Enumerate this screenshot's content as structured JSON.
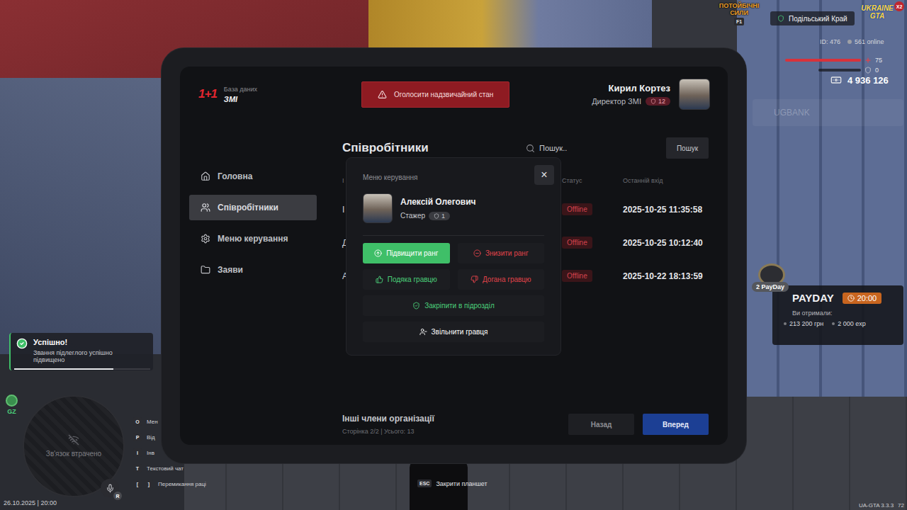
{
  "hud": {
    "event_logo": {
      "title": "ПОТОЙБІЧНІ СИЛИ",
      "key": "F1"
    },
    "server": "Подільський Край",
    "game_logo": {
      "title": "UKRAINE GTA",
      "badge": "X2"
    },
    "player_id": "ID: 476",
    "online": "561 online",
    "health": {
      "value": "75",
      "level": 1
    },
    "armor": {
      "value": "0",
      "level": 0
    },
    "money": "4 936 126",
    "bank": "UGBANK",
    "payday": {
      "count": "2 PayDay",
      "title": "PAYDAY",
      "time": "20:00",
      "received_label": "Ви отримали:",
      "rewards": [
        "213 200 грн",
        "2 000 exp"
      ]
    },
    "notification": {
      "title": "Успішно!",
      "message": "Звання підлеглого успішно підвищено",
      "level": 0.73
    },
    "zone": "GZ",
    "minimap_status": "Зв'язок втрачено",
    "voice_key": "R",
    "hints": [
      {
        "keys": [
          "O"
        ],
        "label": "Мен"
      },
      {
        "keys": [
          "P"
        ],
        "label": "Від"
      },
      {
        "keys": [
          "I"
        ],
        "label": "Інв"
      },
      {
        "keys": [
          "T"
        ],
        "label": "Текстовий чат"
      },
      {
        "keys": [
          "[",
          "]"
        ],
        "label": "Перемикання раці"
      }
    ],
    "datetime": "26.10.2025 | 20:00",
    "close_hint": {
      "key": "ESC",
      "label": "Закрити планшет"
    },
    "version": "UA-GTA 3.3.3",
    "fps": "72"
  },
  "tablet": {
    "brand": {
      "logo": "1+1",
      "subtitle": "База даних",
      "title": "ЗМІ"
    },
    "emergency_button": "Оголосити надзвичайний стан",
    "user": {
      "name": "Кирил Кортез",
      "role": "Директор ЗМІ",
      "rank": "12"
    },
    "sidebar": [
      {
        "label": "Головна",
        "selected": false
      },
      {
        "label": "Співробітники",
        "selected": true
      },
      {
        "label": "Меню керування",
        "selected": false
      },
      {
        "label": "Заяви",
        "selected": false
      }
    ],
    "content": {
      "title": "Співробітники",
      "search_placeholder": "Пошук..",
      "search_button": "Пошук",
      "columns": [
        "І",
        "Статус",
        "Останній вхід"
      ],
      "rows": [
        {
          "name": "І",
          "status": "Offline",
          "last_login": "2025-10-25 11:35:58"
        },
        {
          "name": "Д",
          "status": "Offline",
          "last_login": "2025-10-25 10:12:40"
        },
        {
          "name": "А",
          "status": "Offline",
          "last_login": "2025-10-22 18:13:59"
        }
      ],
      "footer": {
        "title": "Інші члени організації",
        "page_info": "Сторінка 2/2 | Усього: 13",
        "buttons": [
          {
            "label": "Назад",
            "highlighted": false
          },
          {
            "label": "Вперед",
            "highlighted": true
          }
        ]
      }
    },
    "modal": {
      "title": "Меню керування",
      "close": "×",
      "member": {
        "name": "Алексій Олегович",
        "rank_name": "Стажер",
        "rank": "1"
      },
      "action_rows": [
        [
          {
            "label": "Підвищити ранг",
            "color": "#3fbf68",
            "hovered": true
          },
          {
            "label": "Знизити ранг",
            "color": "#e0434a",
            "hovered": false
          }
        ],
        [
          {
            "label": "Подяка гравцю",
            "color": "#4bd07a",
            "hovered": false
          },
          {
            "label": "Догана гравцю",
            "color": "#e0434a",
            "hovered": false
          }
        ],
        [
          {
            "label": "Закріпити в підрозділ",
            "color": "#4bd07a",
            "hovered": false
          }
        ],
        [
          {
            "label": "Звільнити гравця",
            "color": "#ffffff",
            "hovered": false
          }
        ]
      ]
    }
  }
}
